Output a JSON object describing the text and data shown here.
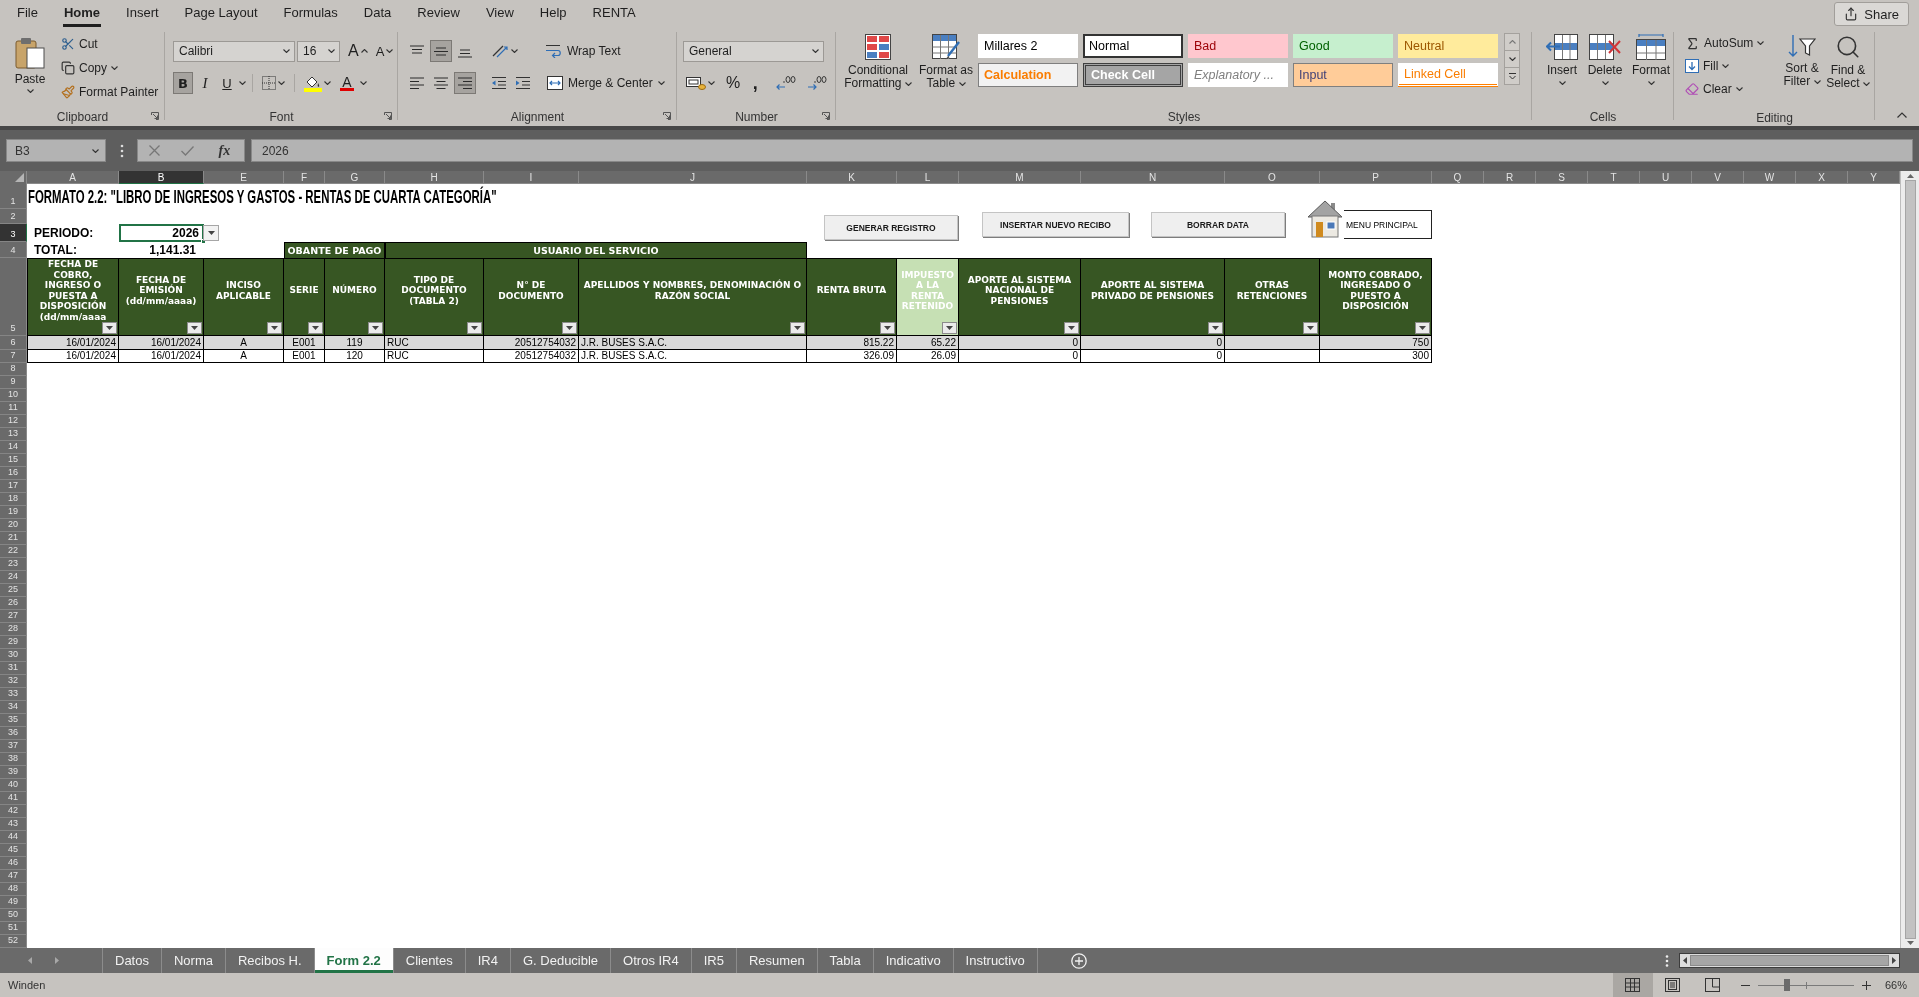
{
  "menu_tabs": [
    {
      "label": "File",
      "selected": false
    },
    {
      "label": "Home",
      "selected": true
    },
    {
      "label": "Insert",
      "selected": false
    },
    {
      "label": "Page Layout",
      "selected": false
    },
    {
      "label": "Formulas",
      "selected": false
    },
    {
      "label": "Data",
      "selected": false
    },
    {
      "label": "Review",
      "selected": false
    },
    {
      "label": "View",
      "selected": false
    },
    {
      "label": "Help",
      "selected": false
    },
    {
      "label": "RENTA",
      "selected": false
    }
  ],
  "share_button": "Share",
  "ribbon": {
    "clipboard": {
      "label": "Clipboard",
      "paste": "Paste",
      "cut": "Cut",
      "copy": "Copy",
      "format_painter": "Format Painter"
    },
    "font": {
      "label": "Font",
      "font_name": "Calibri",
      "font_size": "16",
      "grow_font": "A",
      "shrink_font": "A",
      "style_buttons": [
        {
          "label": "B",
          "kind": "bold",
          "selected": true
        },
        {
          "label": "I",
          "kind": "italic",
          "selected": false
        },
        {
          "label": "U",
          "kind": "underline",
          "selected": false
        }
      ],
      "font_color": "A"
    },
    "alignment": {
      "label": "Alignment",
      "vertical": [
        {
          "kind": "top",
          "selected": false
        },
        {
          "kind": "middle",
          "selected": true
        },
        {
          "kind": "bottom",
          "selected": false
        }
      ],
      "horizontal": [
        {
          "kind": "left",
          "selected": false
        },
        {
          "kind": "center",
          "selected": false
        },
        {
          "kind": "right",
          "selected": true
        }
      ],
      "wrap_text": "Wrap Text",
      "merge_center": "Merge & Center"
    },
    "number": {
      "label": "Number",
      "format": "General",
      "percent": "%",
      "comma": ","
    },
    "styles": {
      "label": "Styles",
      "conditional_formatting": "Conditional Formatting",
      "format_as_table": "Format as Table",
      "gallery": [
        {
          "label": "Millares 2",
          "kind": "normal",
          "selected": false
        },
        {
          "label": "Normal",
          "kind": "normal",
          "selected": true
        },
        {
          "label": "Bad",
          "kind": "bad",
          "selected": false
        },
        {
          "label": "Good",
          "kind": "good",
          "selected": false
        },
        {
          "label": "Neutral",
          "kind": "neutral",
          "selected": false
        },
        {
          "label": "Calculation",
          "kind": "calculation",
          "selected": false
        },
        {
          "label": "Check Cell",
          "kind": "check",
          "selected": false
        },
        {
          "label": "Explanatory ...",
          "kind": "explanatory",
          "selected": false
        },
        {
          "label": "Input",
          "kind": "input",
          "selected": false
        },
        {
          "label": "Linked Cell",
          "kind": "linked",
          "selected": false
        }
      ]
    },
    "cells": {
      "label": "Cells",
      "buttons": [
        {
          "label": "Insert",
          "kind": "insert"
        },
        {
          "label": "Delete",
          "kind": "delete"
        },
        {
          "label": "Format",
          "kind": "format"
        }
      ]
    },
    "editing": {
      "label": "Editing",
      "autosum": "AutoSum",
      "fill": "Fill",
      "clear": "Clear",
      "sort_filter": "Sort & Filter",
      "find_select": "Find & Select"
    }
  },
  "formula_bar": {
    "name_box": "B3",
    "function_label": "fx",
    "formula": "2026"
  },
  "sheet": {
    "column_headers": [
      {
        "label": "A",
        "selected": false
      },
      {
        "label": "B",
        "selected": true
      },
      {
        "label": "E",
        "selected": false
      },
      {
        "label": "F",
        "selected": false
      },
      {
        "label": "G",
        "selected": false
      },
      {
        "label": "H",
        "selected": false
      },
      {
        "label": "I",
        "selected": false
      },
      {
        "label": "J",
        "selected": false
      },
      {
        "label": "K",
        "selected": false
      },
      {
        "label": "L",
        "selected": false
      },
      {
        "label": "M",
        "selected": false
      },
      {
        "label": "N",
        "selected": false
      },
      {
        "label": "O",
        "selected": false
      },
      {
        "label": "P",
        "selected": false
      },
      {
        "label": "Q",
        "selected": false
      },
      {
        "label": "R",
        "selected": false
      },
      {
        "label": "S",
        "selected": false
      },
      {
        "label": "T",
        "selected": false
      },
      {
        "label": "U",
        "selected": false
      },
      {
        "label": "V",
        "selected": false
      },
      {
        "label": "W",
        "selected": false
      },
      {
        "label": "X",
        "selected": false
      },
      {
        "label": "Y",
        "selected": false
      }
    ],
    "row_headers": [
      {
        "label": "1",
        "selected": false
      },
      {
        "label": "2",
        "selected": false
      },
      {
        "label": "3",
        "selected": true
      },
      {
        "label": "4",
        "selected": false
      },
      {
        "label": "5",
        "selected": false
      },
      {
        "label": "6",
        "selected": false
      },
      {
        "label": "7",
        "selected": false
      },
      {
        "label": "8",
        "selected": false
      },
      {
        "label": "9",
        "selected": false
      },
      {
        "label": "10",
        "selected": false
      },
      {
        "label": "11",
        "selected": false
      },
      {
        "label": "12",
        "selected": false
      },
      {
        "label": "13",
        "selected": false
      },
      {
        "label": "14",
        "selected": false
      },
      {
        "label": "15",
        "selected": false
      },
      {
        "label": "16",
        "selected": false
      },
      {
        "label": "17",
        "selected": false
      },
      {
        "label": "18",
        "selected": false
      },
      {
        "label": "19",
        "selected": false
      },
      {
        "label": "20",
        "selected": false
      },
      {
        "label": "21",
        "selected": false
      },
      {
        "label": "22",
        "selected": false
      },
      {
        "label": "23",
        "selected": false
      },
      {
        "label": "24",
        "selected": false
      },
      {
        "label": "25",
        "selected": false
      },
      {
        "label": "26",
        "selected": false
      },
      {
        "label": "27",
        "selected": false
      },
      {
        "label": "28",
        "selected": false
      },
      {
        "label": "29",
        "selected": false
      },
      {
        "label": "30",
        "selected": false
      },
      {
        "label": "31",
        "selected": false
      },
      {
        "label": "32",
        "selected": false
      },
      {
        "label": "33",
        "selected": false
      },
      {
        "label": "34",
        "selected": false
      },
      {
        "label": "35",
        "selected": false
      },
      {
        "label": "36",
        "selected": false
      },
      {
        "label": "37",
        "selected": false
      },
      {
        "label": "38",
        "selected": false
      },
      {
        "label": "39",
        "selected": false
      },
      {
        "label": "40",
        "selected": false
      },
      {
        "label": "41",
        "selected": false
      },
      {
        "label": "42",
        "selected": false
      },
      {
        "label": "43",
        "selected": false
      },
      {
        "label": "44",
        "selected": false
      },
      {
        "label": "45",
        "selected": false
      },
      {
        "label": "46",
        "selected": false
      },
      {
        "label": "47",
        "selected": false
      },
      {
        "label": "48",
        "selected": false
      },
      {
        "label": "49",
        "selected": false
      },
      {
        "label": "50",
        "selected": false
      },
      {
        "label": "51",
        "selected": false
      },
      {
        "label": "52",
        "selected": false
      }
    ],
    "title": "FORMATO 2.2: \"LIBRO DE INGRESOS Y GASTOS - RENTAS DE CUARTA CATEGORÍA\"",
    "period_label": "PERIODO:",
    "period_value": "2026",
    "total_label": "TOTAL:",
    "total_value": "1,141.31",
    "group_headers": [
      "OBANTE DE PAGO",
      "USUARIO DEL SERVICIO"
    ],
    "macro_buttons": [
      "GENERAR REGISTRO",
      "INSERTAR NUEVO RECIBO",
      "BORRAR DATA"
    ],
    "menu_button": "MENU PRINCIPAL",
    "table": {
      "columns": [
        {
          "label": "FECHA DE COBRO, INGRESO O PUESTA A DISPOSICIÓN (dd/mm/aaaa",
          "highlighted": false
        },
        {
          "label": "FECHA DE EMISIÓN (dd/mm/aaaa)",
          "highlighted": false
        },
        {
          "label": "INCISO APLICABLE",
          "highlighted": false
        },
        {
          "label": "SERIE",
          "highlighted": false
        },
        {
          "label": "NÚMERO",
          "highlighted": false
        },
        {
          "label": "TIPO DE DOCUMENTO (TABLA 2)",
          "highlighted": false
        },
        {
          "label": "N° DE DOCUMENTO",
          "highlighted": false
        },
        {
          "label": "APELLIDOS Y NOMBRES, DENOMINACIÓN O RAZÓN SOCIAL",
          "highlighted": false
        },
        {
          "label": "RENTA BRUTA",
          "highlighted": false
        },
        {
          "label": "IMPUESTO A LA RENTA RETENIDO",
          "highlighted": true
        },
        {
          "label": "APORTE AL SISTEMA NACIONAL DE PENSIONES",
          "highlighted": false
        },
        {
          "label": "APORTE AL SISTEMA PRIVADO DE PENSIONES",
          "highlighted": false
        },
        {
          "label": "OTRAS RETENCIONES",
          "highlighted": false
        },
        {
          "label": "MONTO COBRADO, INGRESADO O PUESTO A DISPOSICIÓN",
          "highlighted": false
        }
      ],
      "rows": [
        {
          "banded": true,
          "cells": [
            "16/01/2024",
            "16/01/2024",
            "A",
            "E001",
            "119",
            "RUC",
            "20512754032",
            "J.R. BUSES S.A.C.",
            "815.22",
            "65.22",
            "0",
            "0",
            null,
            "750"
          ]
        },
        {
          "banded": false,
          "cells": [
            "16/01/2024",
            "16/01/2024",
            "A",
            "E001",
            "120",
            "RUC",
            "20512754032",
            "J.R. BUSES S.A.C.",
            "326.09",
            "26.09",
            "0",
            "0",
            null,
            "300"
          ]
        }
      ]
    }
  },
  "sheet_tabs": [
    {
      "label": "Datos",
      "selected": false
    },
    {
      "label": "Norma",
      "selected": false
    },
    {
      "label": "Recibos H.",
      "selected": false
    },
    {
      "label": "Form 2.2",
      "selected": true
    },
    {
      "label": "Clientes",
      "selected": false
    },
    {
      "label": "IR4",
      "selected": false
    },
    {
      "label": "G. Deducible",
      "selected": false
    },
    {
      "label": "Otros IR4",
      "selected": false
    },
    {
      "label": "IR5",
      "selected": false
    },
    {
      "label": "Resumen",
      "selected": false
    },
    {
      "label": "Tabla",
      "selected": false
    },
    {
      "label": "Indicativo",
      "selected": false
    },
    {
      "label": "Instructivo",
      "selected": false
    }
  ],
  "status_bar": {
    "text": "Winden",
    "view_buttons": [
      {
        "kind": "normal",
        "selected": true
      },
      {
        "kind": "page_layout",
        "selected": false
      },
      {
        "kind": "page_break",
        "selected": false
      }
    ],
    "zoom": {
      "level": 0.3,
      "label": "66%"
    }
  }
}
